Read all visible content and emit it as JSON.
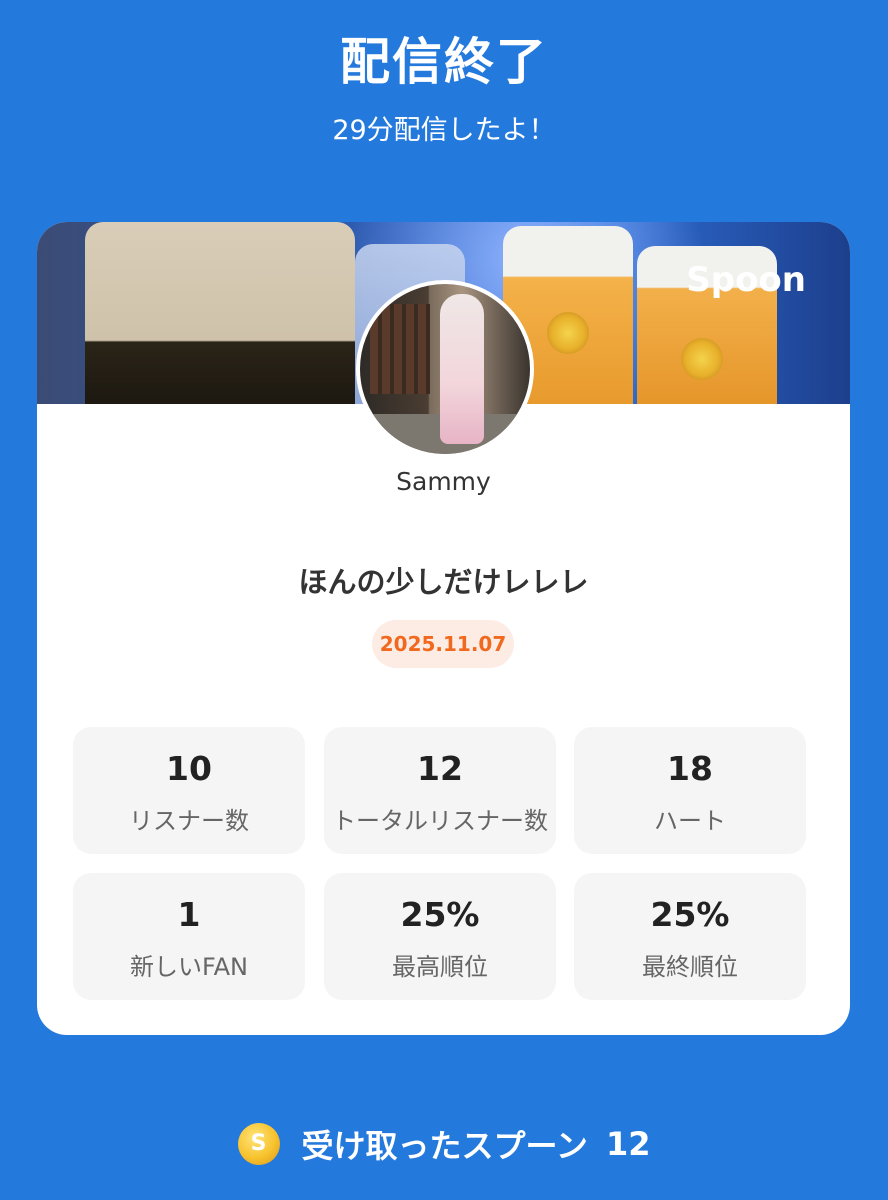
{
  "header": {
    "title": "配信終了",
    "subtitle": "29分配信したよ！"
  },
  "card": {
    "brand": "Spoon",
    "username": "Sammy",
    "stream_title": "ほんの少しだけレレレ",
    "date": "2025.11.07",
    "stats": [
      {
        "value": "10",
        "label": "リスナー数"
      },
      {
        "value": "12",
        "label": "トータルリスナー数"
      },
      {
        "value": "18",
        "label": "ハート"
      },
      {
        "value": "1",
        "label": "新しいFAN"
      },
      {
        "value": "25%",
        "label": "最高順位"
      },
      {
        "value": "25%",
        "label": "最終順位"
      }
    ]
  },
  "footer": {
    "coin_symbol": "S",
    "label": "受け取ったスプーン",
    "count": "12"
  },
  "colors": {
    "background": "#2479DC",
    "date_badge_text": "#F0691F",
    "date_badge_bg": "#FDECE4"
  }
}
